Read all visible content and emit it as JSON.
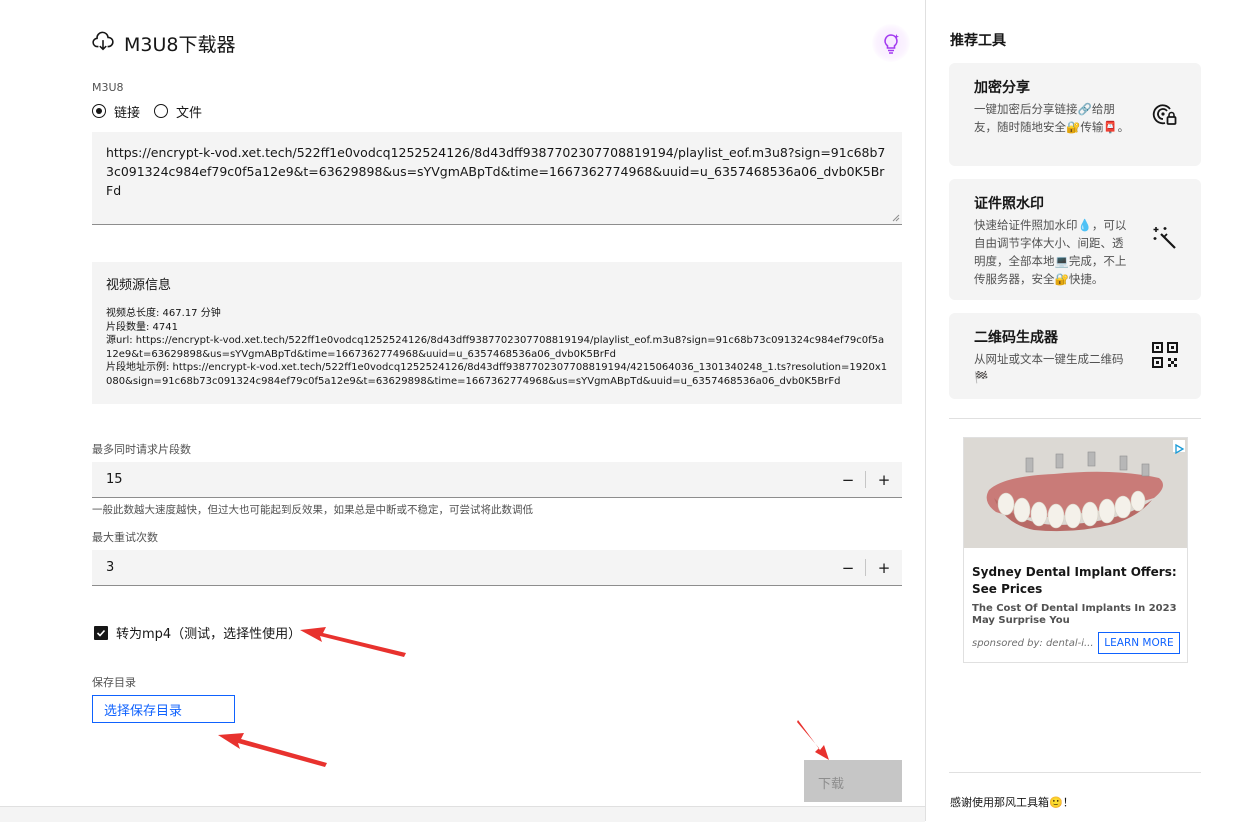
{
  "header": {
    "title": "M3U8下载器",
    "icon": "cloud-download-icon",
    "theme_icon": "bulb-icon"
  },
  "source": {
    "label": "M3U8",
    "options": [
      "链接",
      "文件"
    ],
    "selected": "链接",
    "url_value": "https://encrypt-k-vod.xet.tech/522ff1e0vodcq1252524126/8d43dff9387702307708819194/playlist_eof.m3u8?sign=91c68b73c091324c984ef79c0f5a12e9&t=63629898&us=sYVgmABpTd&time=1667362774968&uuid=u_6357468536a06_dvb0K5BrFd"
  },
  "info": {
    "title": "视频源信息",
    "duration": "视频总长度: 467.17 分钟",
    "segments": "片段数量: 4741",
    "source_url": "源url: https://encrypt-k-vod.xet.tech/522ff1e0vodcq1252524126/8d43dff9387702307708819194/playlist_eof.m3u8?sign=91c68b73c091324c984ef79c0f5a12e9&t=63629898&us=sYVgmABpTd&time=1667362774968&uuid=u_6357468536a06_dvb0K5BrFd",
    "segment_example": "片段地址示例: https://encrypt-k-vod.xet.tech/522ff1e0vodcq1252524126/8d43dff9387702307708819194/4215064036_1301340248_1.ts?resolution=1920x1080&sign=91c68b73c091324c984ef79c0f5a12e9&t=63629898&time=1667362774968&us=sYVgmABpTd&uuid=u_6357468536a06_dvb0K5BrFd"
  },
  "concurrency": {
    "label": "最多同时请求片段数",
    "value": "15",
    "helper": "一般此数越大速度越快，但过大也可能起到反效果，如果总是中断或不稳定，可尝试将此数调低",
    "minus": "−",
    "plus": "+"
  },
  "retries": {
    "label": "最大重试次数",
    "value": "3",
    "minus": "−",
    "plus": "+"
  },
  "convert": {
    "label": "转为mp4（测试，选择性使用）",
    "checked": true
  },
  "save": {
    "label": "保存目录",
    "button": "选择保存目录"
  },
  "download_button": "下载",
  "sidebar": {
    "title": "推荐工具",
    "cards": [
      {
        "title": "加密分享",
        "desc": "一键加密后分享链接🔗给朋友，随时随地安全🔐传输📮。",
        "icon": "lock-fingerprint-icon"
      },
      {
        "title": "证件照水印",
        "desc": "快速给证件照加水印💧，可以自由调节字体大小、间距、透明度，全部本地💻完成，不上传服务器，安全🔐快捷。",
        "icon": "magic-wand-icon"
      },
      {
        "title": "二维码生成器",
        "desc": "从网址或文本一键生成二维码🏁",
        "icon": "qr-code-icon"
      }
    ],
    "ad": {
      "headline": "Sydney Dental Implant Offers: See Prices",
      "sub": "The Cost Of Dental Implants In 2023 May Surprise You",
      "sponsor": "sponsored by: dental-i...",
      "cta": "LEARN MORE"
    },
    "thanks": "感谢使用那风工具箱🙂！"
  },
  "colors": {
    "accent": "#0f62fe",
    "arrow": "#e8322e",
    "field_bg": "#f4f4f4"
  }
}
